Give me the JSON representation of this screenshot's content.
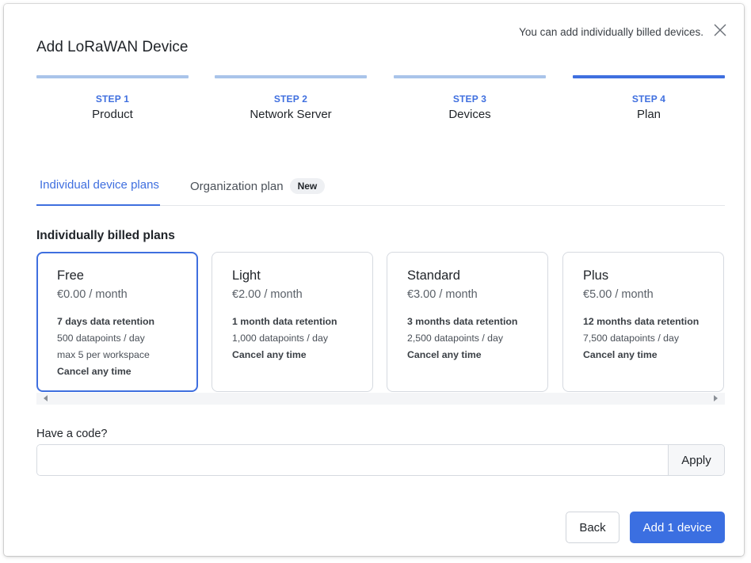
{
  "dialog": {
    "title": "Add LoRaWAN Device",
    "hint": "You can add individually billed devices."
  },
  "steps": [
    {
      "num": "STEP 1",
      "name": "Product"
    },
    {
      "num": "STEP 2",
      "name": "Network Server"
    },
    {
      "num": "STEP 3",
      "name": "Devices"
    },
    {
      "num": "STEP 4",
      "name": "Plan"
    }
  ],
  "active_step": 4,
  "tabs": {
    "individual": "Individual device plans",
    "organization": "Organization plan",
    "organization_badge": "New"
  },
  "section_title": "Individually billed plans",
  "plans": [
    {
      "name": "Free",
      "price": "€0.00 / month",
      "features": [
        "7 days data retention",
        "500 datapoints / day",
        "max 5 per workspace",
        "Cancel any time"
      ],
      "selected": true
    },
    {
      "name": "Light",
      "price": "€2.00 / month",
      "features": [
        "1 month data retention",
        "1,000 datapoints / day",
        "Cancel any time"
      ],
      "selected": false
    },
    {
      "name": "Standard",
      "price": "€3.00 / month",
      "features": [
        "3 months data retention",
        "2,500 datapoints / day",
        "Cancel any time"
      ],
      "selected": false
    },
    {
      "name": "Plus",
      "price": "€5.00 / month",
      "features": [
        "12 months data retention",
        "7,500 datapoints / day",
        "Cancel any time"
      ],
      "selected": false
    }
  ],
  "code": {
    "label": "Have a code?",
    "value": "",
    "placeholder": "",
    "apply_label": "Apply"
  },
  "footer": {
    "back_label": "Back",
    "submit_label": "Add 1 device"
  },
  "colors": {
    "accent": "#3f6fdf",
    "step_inactive": "#a9c4ea",
    "primary_button": "#3b6fe1"
  },
  "icons": {
    "close": "close-icon",
    "scroll_left": "scroll-left-arrow-icon",
    "scroll_right": "scroll-right-arrow-icon"
  }
}
